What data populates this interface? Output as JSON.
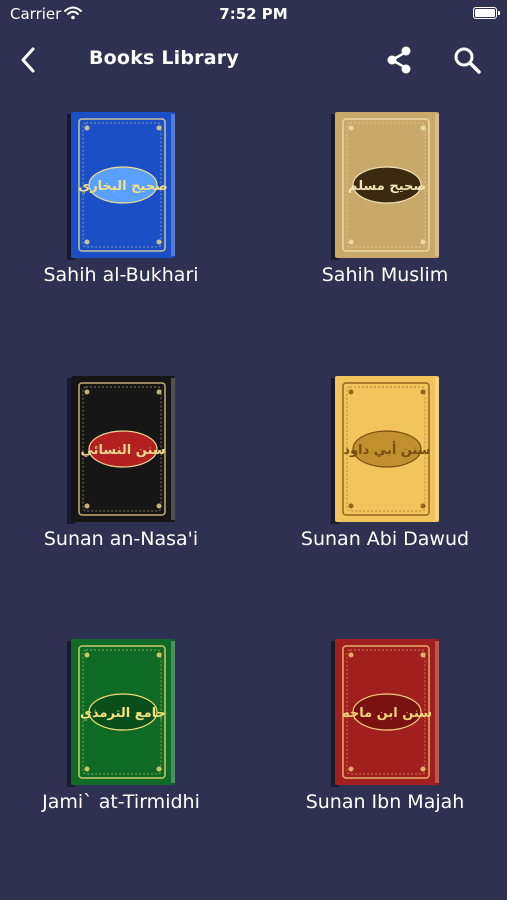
{
  "status": {
    "carrier": "Carrier",
    "time": "7:52 PM"
  },
  "header": {
    "title": "Books Library"
  },
  "books": [
    {
      "title": "Sahih al-Bukhari",
      "arabic": "صحيح البخاري",
      "cover": "#1a4fc7",
      "accent": "#5aa0ff",
      "text": "#f3e08a"
    },
    {
      "title": "Sahih Muslim",
      "arabic": "صحيح مسلم",
      "cover": "#c9a96a",
      "accent": "#3b2a10",
      "text": "#f2e2b5"
    },
    {
      "title": "Sunan an-Nasa'i",
      "arabic": "سنن النسائي",
      "cover": "#161616",
      "accent": "#b32020",
      "text": "#f0d890"
    },
    {
      "title": "Sunan Abi Dawud",
      "arabic": "سنن أبي داود",
      "cover": "#f1c55c",
      "accent": "#c0902f",
      "text": "#7a4c10"
    },
    {
      "title": "Jami` at-Tirmidhi",
      "arabic": "جامع الترمذي",
      "cover": "#0f6a25",
      "accent": "#0a4f1b",
      "text": "#f6e27a"
    },
    {
      "title": "Sunan Ibn Majah",
      "arabic": "سنن ابن ماجه",
      "cover": "#a11f1f",
      "accent": "#7b1212",
      "text": "#f4d27a"
    }
  ]
}
